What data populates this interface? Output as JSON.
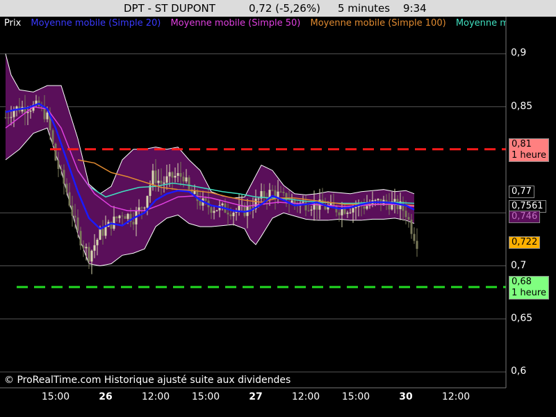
{
  "header": {
    "symbol": "DPT - ST DUPONT",
    "quote": "0,72 (-5,26%)",
    "interval": "5 minutes",
    "time": "9:34"
  },
  "legend": {
    "prix": "Prix",
    "ma20": "Moyenne mobile (Simple 20)",
    "ma50": "Moyenne mobile (Simple 50)",
    "ma100": "Moyenne mobile (Simple 100)",
    "ma_extra": "Moyenne mobile"
  },
  "copyright": "© ProRealTime.com Historique ajusté suite aux dividendes",
  "colors": {
    "background": "#000000",
    "band_fill": "#5a0f5a",
    "band_edge": "#ffffff",
    "ma20": "#1a1aff",
    "ma50": "#e040e0",
    "ma100": "#e08a30",
    "ma_extra": "#40e0c0",
    "resistance": "#ff1a1a",
    "support": "#22dd22",
    "candle_up": "#d8d8b0",
    "candle_down": "#7a7a5a"
  },
  "chart_data": {
    "type": "line",
    "title": "DPT - ST DUPONT",
    "ylim": [
      0.585,
      0.935
    ],
    "y_ticks": [
      "0,9",
      "0,85",
      "0,75",
      "0,7",
      "0,65",
      "0,6"
    ],
    "x_ticks": [
      {
        "label": "15:00",
        "day": false
      },
      {
        "label": "26",
        "day": true
      },
      {
        "label": "12:00",
        "day": false
      },
      {
        "label": "15:00",
        "day": false
      },
      {
        "label": "27",
        "day": true
      },
      {
        "label": "12:00",
        "day": false
      },
      {
        "label": "15:00",
        "day": false
      },
      {
        "label": "30",
        "day": true
      },
      {
        "label": "12:00",
        "day": false
      }
    ],
    "x_tick_bar_index": [
      18,
      36,
      54,
      72,
      90,
      108,
      126,
      144,
      162
    ],
    "bar_count": 185,
    "last_bar_index": 148,
    "price_path": [
      [
        0,
        0.84
      ],
      [
        3,
        0.848
      ],
      [
        8,
        0.85
      ],
      [
        12,
        0.85
      ],
      [
        15,
        0.84
      ],
      [
        18,
        0.8
      ],
      [
        22,
        0.77
      ],
      [
        26,
        0.73
      ],
      [
        30,
        0.71
      ],
      [
        34,
        0.73
      ],
      [
        38,
        0.74
      ],
      [
        42,
        0.75
      ],
      [
        46,
        0.745
      ],
      [
        50,
        0.76
      ],
      [
        53,
        0.785
      ],
      [
        56,
        0.778
      ],
      [
        60,
        0.784
      ],
      [
        64,
        0.785
      ],
      [
        66,
        0.77
      ],
      [
        70,
        0.76
      ],
      [
        74,
        0.755
      ],
      [
        78,
        0.754
      ],
      [
        82,
        0.752
      ],
      [
        86,
        0.752
      ],
      [
        88,
        0.755
      ],
      [
        92,
        0.765
      ],
      [
        96,
        0.77
      ],
      [
        100,
        0.764
      ],
      [
        104,
        0.759
      ],
      [
        110,
        0.758
      ],
      [
        116,
        0.755
      ],
      [
        120,
        0.753
      ],
      [
        126,
        0.756
      ],
      [
        130,
        0.757
      ],
      [
        134,
        0.76
      ],
      [
        138,
        0.759
      ],
      [
        142,
        0.756
      ],
      [
        144,
        0.75
      ],
      [
        146,
        0.735
      ],
      [
        148,
        0.722
      ]
    ],
    "series": [
      {
        "name": "Moyenne mobile (Simple 20)",
        "color": "#1a1aff",
        "points": [
          [
            0,
            0.845
          ],
          [
            3,
            0.847
          ],
          [
            8,
            0.849
          ],
          [
            12,
            0.853
          ],
          [
            15,
            0.848
          ],
          [
            18,
            0.83
          ],
          [
            22,
            0.8
          ],
          [
            26,
            0.77
          ],
          [
            30,
            0.745
          ],
          [
            34,
            0.735
          ],
          [
            38,
            0.74
          ],
          [
            42,
            0.738
          ],
          [
            46,
            0.745
          ],
          [
            50,
            0.75
          ],
          [
            54,
            0.762
          ],
          [
            58,
            0.768
          ],
          [
            62,
            0.771
          ],
          [
            66,
            0.77
          ],
          [
            70,
            0.762
          ],
          [
            74,
            0.757
          ],
          [
            78,
            0.755
          ],
          [
            82,
            0.752
          ],
          [
            86,
            0.751
          ],
          [
            88,
            0.752
          ],
          [
            92,
            0.758
          ],
          [
            96,
            0.766
          ],
          [
            100,
            0.762
          ],
          [
            104,
            0.757
          ],
          [
            108,
            0.758
          ],
          [
            112,
            0.76
          ],
          [
            116,
            0.756
          ],
          [
            120,
            0.754
          ],
          [
            124,
            0.755
          ],
          [
            128,
            0.758
          ],
          [
            132,
            0.76
          ],
          [
            136,
            0.76
          ],
          [
            140,
            0.759
          ],
          [
            144,
            0.757
          ],
          [
            147,
            0.753
          ]
        ]
      },
      {
        "name": "Moyenne mobile (Simple 50)",
        "color": "#e040e0",
        "points": [
          [
            0,
            0.83
          ],
          [
            5,
            0.84
          ],
          [
            10,
            0.85
          ],
          [
            15,
            0.848
          ],
          [
            20,
            0.83
          ],
          [
            26,
            0.79
          ],
          [
            32,
            0.768
          ],
          [
            38,
            0.756
          ],
          [
            44,
            0.752
          ],
          [
            50,
            0.752
          ],
          [
            56,
            0.758
          ],
          [
            62,
            0.765
          ],
          [
            68,
            0.766
          ],
          [
            74,
            0.764
          ],
          [
            80,
            0.76
          ],
          [
            86,
            0.756
          ],
          [
            92,
            0.758
          ],
          [
            98,
            0.76
          ],
          [
            104,
            0.759
          ],
          [
            110,
            0.758
          ],
          [
            116,
            0.757
          ],
          [
            122,
            0.756
          ],
          [
            128,
            0.757
          ],
          [
            134,
            0.758
          ],
          [
            140,
            0.758
          ],
          [
            147,
            0.756
          ]
        ]
      },
      {
        "name": "Moyenne mobile (Simple 100)",
        "color": "#e08a30",
        "points": [
          [
            26,
            0.8
          ],
          [
            32,
            0.797
          ],
          [
            38,
            0.788
          ],
          [
            44,
            0.784
          ],
          [
            50,
            0.779
          ],
          [
            56,
            0.774
          ],
          [
            62,
            0.772
          ],
          [
            68,
            0.771
          ],
          [
            74,
            0.769
          ],
          [
            80,
            0.765
          ],
          [
            86,
            0.762
          ],
          [
            92,
            0.76
          ],
          [
            98,
            0.764
          ],
          [
            104,
            0.764
          ],
          [
            110,
            0.762
          ],
          [
            116,
            0.76
          ],
          [
            122,
            0.758
          ],
          [
            128,
            0.758
          ],
          [
            134,
            0.758
          ],
          [
            140,
            0.758
          ],
          [
            147,
            0.757
          ]
        ]
      },
      {
        "name": "Moyenne mobile",
        "color": "#40e0c0",
        "points": [
          [
            26,
            0.79
          ],
          [
            30,
            0.775
          ],
          [
            36,
            0.765
          ],
          [
            42,
            0.77
          ],
          [
            48,
            0.774
          ],
          [
            54,
            0.775
          ],
          [
            60,
            0.778
          ],
          [
            66,
            0.776
          ],
          [
            72,
            0.773
          ],
          [
            78,
            0.77
          ],
          [
            84,
            0.768
          ],
          [
            90,
            0.765
          ],
          [
            96,
            0.764
          ],
          [
            102,
            0.763
          ],
          [
            108,
            0.761
          ],
          [
            114,
            0.76
          ],
          [
            120,
            0.759
          ],
          [
            126,
            0.759
          ],
          [
            132,
            0.76
          ],
          [
            138,
            0.76
          ],
          [
            147,
            0.759
          ]
        ]
      }
    ],
    "band_upper": [
      [
        0,
        0.9
      ],
      [
        2,
        0.88
      ],
      [
        5,
        0.866
      ],
      [
        10,
        0.864
      ],
      [
        15,
        0.87
      ],
      [
        20,
        0.87
      ],
      [
        26,
        0.82
      ],
      [
        30,
        0.777
      ],
      [
        34,
        0.768
      ],
      [
        38,
        0.775
      ],
      [
        42,
        0.8
      ],
      [
        46,
        0.81
      ],
      [
        50,
        0.81
      ],
      [
        54,
        0.812
      ],
      [
        58,
        0.81
      ],
      [
        62,
        0.812
      ],
      [
        66,
        0.8
      ],
      [
        70,
        0.79
      ],
      [
        74,
        0.77
      ],
      [
        78,
        0.766
      ],
      [
        82,
        0.764
      ],
      [
        86,
        0.765
      ],
      [
        88,
        0.775
      ],
      [
        92,
        0.795
      ],
      [
        96,
        0.79
      ],
      [
        100,
        0.776
      ],
      [
        104,
        0.768
      ],
      [
        108,
        0.767
      ],
      [
        112,
        0.768
      ],
      [
        116,
        0.77
      ],
      [
        120,
        0.769
      ],
      [
        124,
        0.768
      ],
      [
        128,
        0.77
      ],
      [
        132,
        0.771
      ],
      [
        136,
        0.772
      ],
      [
        140,
        0.77
      ],
      [
        144,
        0.771
      ],
      [
        147,
        0.768
      ]
    ],
    "band_lower": [
      [
        0,
        0.8
      ],
      [
        5,
        0.81
      ],
      [
        10,
        0.825
      ],
      [
        15,
        0.83
      ],
      [
        20,
        0.79
      ],
      [
        26,
        0.73
      ],
      [
        30,
        0.702
      ],
      [
        34,
        0.7
      ],
      [
        38,
        0.702
      ],
      [
        42,
        0.71
      ],
      [
        46,
        0.712
      ],
      [
        50,
        0.716
      ],
      [
        54,
        0.737
      ],
      [
        58,
        0.745
      ],
      [
        62,
        0.748
      ],
      [
        66,
        0.74
      ],
      [
        70,
        0.737
      ],
      [
        74,
        0.737
      ],
      [
        78,
        0.738
      ],
      [
        82,
        0.739
      ],
      [
        86,
        0.735
      ],
      [
        88,
        0.725
      ],
      [
        90,
        0.72
      ],
      [
        92,
        0.728
      ],
      [
        96,
        0.745
      ],
      [
        100,
        0.75
      ],
      [
        104,
        0.747
      ],
      [
        108,
        0.744
      ],
      [
        112,
        0.743
      ],
      [
        116,
        0.743
      ],
      [
        120,
        0.744
      ],
      [
        124,
        0.743
      ],
      [
        128,
        0.743
      ],
      [
        132,
        0.744
      ],
      [
        136,
        0.744
      ],
      [
        140,
        0.745
      ],
      [
        144,
        0.743
      ],
      [
        147,
        0.74
      ]
    ],
    "lines": [
      {
        "name": "resistance",
        "value": 0.81,
        "label": "0,81",
        "sublabel": "1 heure",
        "color": "#ff1a1a"
      },
      {
        "name": "support",
        "value": 0.68,
        "label": "0,68",
        "sublabel": "1 heure",
        "color": "#22dd22"
      }
    ],
    "value_tags": [
      {
        "name": "tag-077",
        "label": "0,77",
        "value": 0.77,
        "bg": "#000000",
        "fg": "#ffffff"
      },
      {
        "name": "tag-07561",
        "label": "0,7561",
        "value": 0.7561,
        "bg": "#000000",
        "fg": "#ffffff"
      },
      {
        "name": "tag-0746",
        "label": "0,746",
        "value": 0.746,
        "bg": "#5a0f5a",
        "fg": "#c070c0"
      },
      {
        "name": "tag-0722",
        "label": "0,722",
        "value": 0.722,
        "bg": "#ffb000",
        "fg": "#000000"
      }
    ]
  }
}
